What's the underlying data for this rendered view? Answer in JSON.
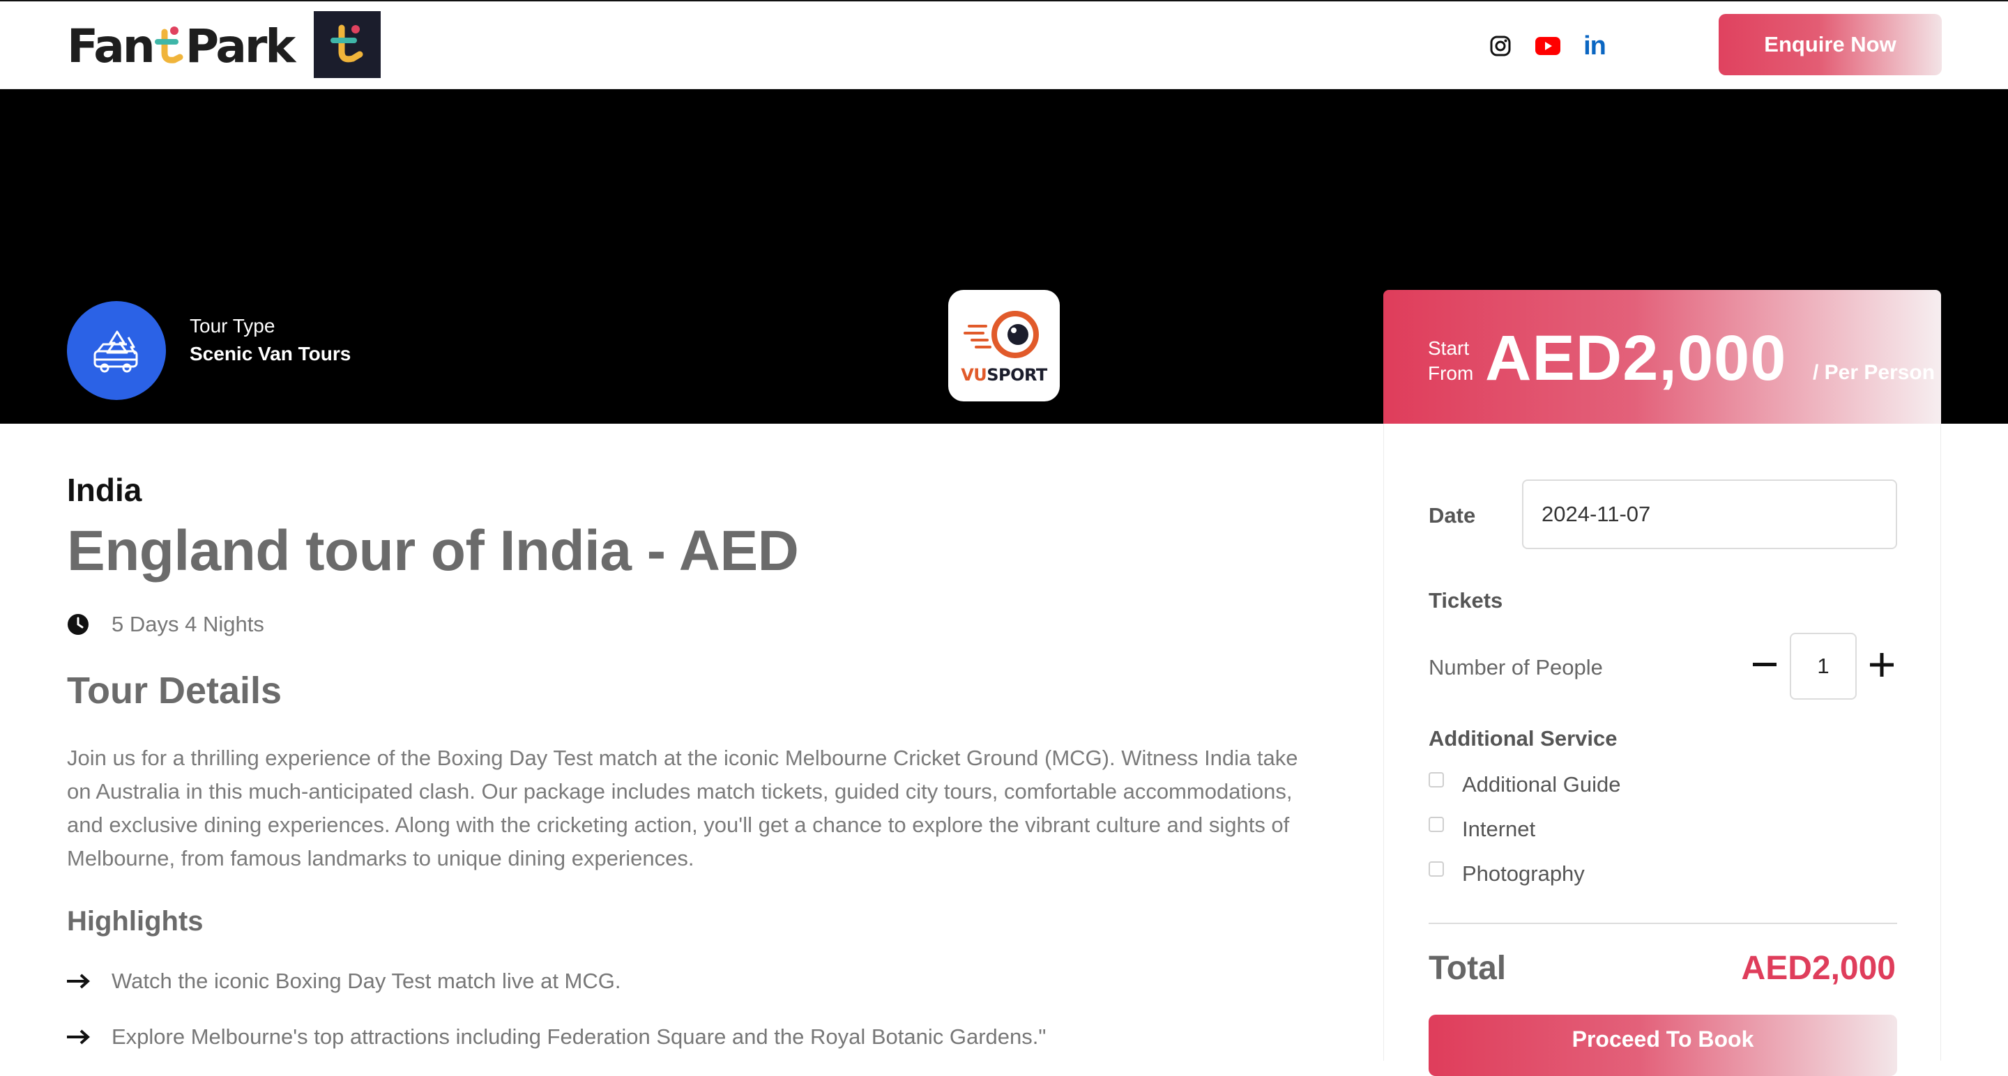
{
  "header": {
    "logo_left": "Fan",
    "logo_right": "Park",
    "social": [
      "instagram-icon",
      "youtube-icon",
      "linkedin-icon"
    ],
    "linkedin_text": "in",
    "enquire_label": "Enquire Now"
  },
  "hero": {
    "tour_type_label": "Tour Type",
    "tour_type_value": "Scenic Van Tours",
    "partner_logo": {
      "v": "VU",
      "s": "SPORT"
    }
  },
  "price": {
    "start_line1": "Start",
    "start_line2": "From",
    "amount": "AED2,000",
    "per": "/ Per Person"
  },
  "booking": {
    "date_label": "Date",
    "date_value": "2024-11-07",
    "tickets_label": "Tickets",
    "people_label": "Number of People",
    "people_value": "1",
    "additional_label": "Additional Service",
    "services": [
      "Additional Guide",
      "Internet",
      "Photography"
    ],
    "total_label": "Total",
    "total_value": "AED2,000",
    "proceed_label": "Proceed To Book"
  },
  "tour": {
    "country": "India",
    "title": "England tour of India - AED",
    "duration": "5 Days 4 Nights",
    "details_heading": "Tour Details",
    "details_text": "Join us for a thrilling experience of the Boxing Day Test match at the iconic Melbourne Cricket Ground (MCG). Witness India take on Australia in this much-anticipated clash. Our package includes match tickets, guided city tours, comfortable accommodations, and exclusive dining experiences. Along with the cricketing action, you'll get a chance to explore the vibrant culture and sights of Melbourne, from famous landmarks to unique dining experiences.",
    "highlights_heading": "Highlights",
    "highlights": [
      "Watch the iconic Boxing Day Test match live at MCG.",
      "Explore Melbourne's top attractions including Federation Square and the Royal Botanic Gardens.\""
    ]
  },
  "colors": {
    "accent": "#df3d5b",
    "hero_bg": "#000000",
    "badge_blue": "#2b62e6"
  }
}
